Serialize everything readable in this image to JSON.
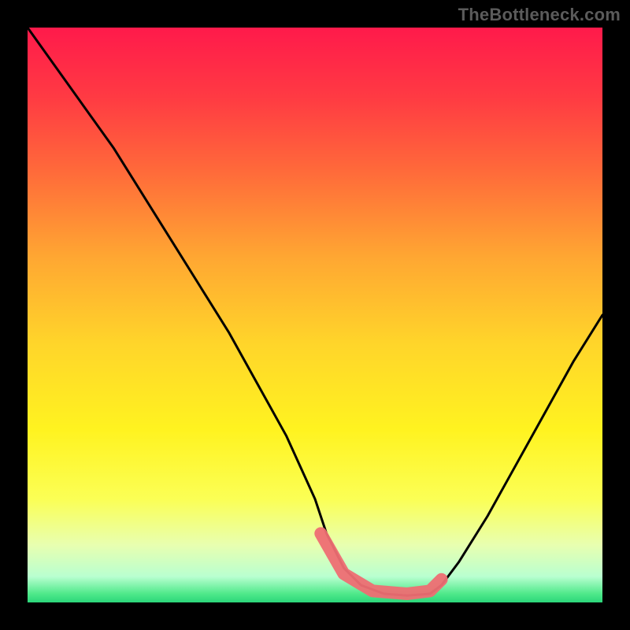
{
  "watermark": "TheBottleneck.com",
  "gradient_stops": [
    {
      "offset": 0.0,
      "color": "#ff1a4b"
    },
    {
      "offset": 0.12,
      "color": "#ff3a43"
    },
    {
      "offset": 0.25,
      "color": "#ff6a3a"
    },
    {
      "offset": 0.4,
      "color": "#ffa732"
    },
    {
      "offset": 0.55,
      "color": "#ffd52a"
    },
    {
      "offset": 0.7,
      "color": "#fff320"
    },
    {
      "offset": 0.82,
      "color": "#fbff55"
    },
    {
      "offset": 0.9,
      "color": "#e8ffb0"
    },
    {
      "offset": 0.955,
      "color": "#b9ffd0"
    },
    {
      "offset": 0.985,
      "color": "#4fe98a"
    },
    {
      "offset": 1.0,
      "color": "#2bd67a"
    }
  ],
  "chart_data": {
    "type": "line",
    "title": "",
    "xlabel": "",
    "ylabel": "",
    "xlim": [
      0,
      100
    ],
    "ylim": [
      0,
      100
    ],
    "series": [
      {
        "name": "curve",
        "x": [
          0,
          5,
          10,
          15,
          20,
          25,
          30,
          35,
          40,
          45,
          50,
          52,
          55,
          58,
          62,
          66,
          70,
          72,
          75,
          80,
          85,
          90,
          95,
          100
        ],
        "y": [
          100,
          93,
          86,
          79,
          71,
          63,
          55,
          47,
          38,
          29,
          18,
          12,
          6,
          3,
          1.5,
          1.2,
          1.5,
          3,
          7,
          15,
          24,
          33,
          42,
          50
        ]
      },
      {
        "name": "highlight-band",
        "x": [
          51,
          55,
          60,
          66,
          70,
          72
        ],
        "y": [
          12,
          5,
          2,
          1.5,
          2,
          4
        ]
      }
    ]
  }
}
